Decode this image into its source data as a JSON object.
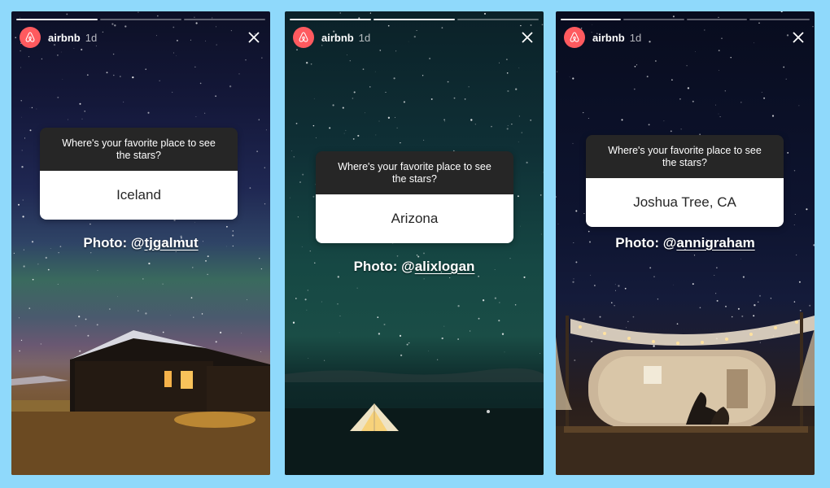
{
  "stories": [
    {
      "user": {
        "name": "airbnb",
        "time": "1d"
      },
      "question": "Where's your favorite place to see the stars?",
      "answer": "Iceland",
      "credit": {
        "prefix": "Photo: @",
        "handle": "tjgalmut"
      },
      "progress": {
        "segments": 3,
        "completed": 1
      },
      "icons": {
        "avatar": "airbnb-logo-icon",
        "close": "close-icon"
      }
    },
    {
      "user": {
        "name": "airbnb",
        "time": "1d"
      },
      "question": "Where's your favorite place to see the stars?",
      "answer": "Arizona",
      "credit": {
        "prefix": "Photo: @",
        "handle": "alixlogan"
      },
      "progress": {
        "segments": 3,
        "completed": 2
      },
      "icons": {
        "avatar": "airbnb-logo-icon",
        "close": "close-icon"
      }
    },
    {
      "user": {
        "name": "airbnb",
        "time": "1d"
      },
      "question": "Where's your favorite place to see the stars?",
      "answer": "Joshua Tree, CA",
      "credit": {
        "prefix": "Photo: @",
        "handle": "annigraham"
      },
      "progress": {
        "segments": 4,
        "completed": 1
      },
      "icons": {
        "avatar": "airbnb-logo-icon",
        "close": "close-icon"
      }
    }
  ],
  "colors": {
    "background": "#8fd9fb",
    "brand": "#ff5a5f",
    "question_bg": "#262626",
    "answer_bg": "#ffffff"
  }
}
